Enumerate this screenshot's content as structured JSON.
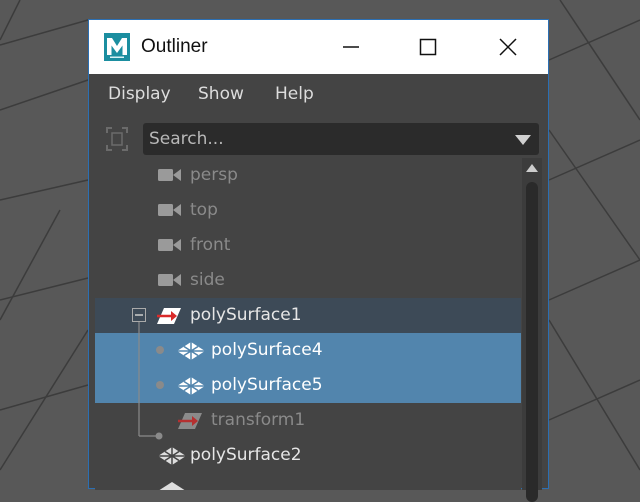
{
  "window": {
    "title": "Outliner",
    "accent_border": "#2b6fb3",
    "app_icon": "maya-logo-icon"
  },
  "menubar": {
    "items": [
      {
        "label": "Display"
      },
      {
        "label": "Show"
      },
      {
        "label": "Help"
      }
    ]
  },
  "search": {
    "placeholder": "Search...",
    "value": ""
  },
  "outliner": {
    "items": [
      {
        "label": "persp",
        "icon": "camera-icon",
        "state": "dim"
      },
      {
        "label": "top",
        "icon": "camera-icon",
        "state": "dim"
      },
      {
        "label": "front",
        "icon": "camera-icon",
        "state": "dim"
      },
      {
        "label": "side",
        "icon": "camera-icon",
        "state": "dim"
      },
      {
        "label": "polySurface1",
        "icon": "transform-icon",
        "state": "parent-highlight",
        "expanded": true
      },
      {
        "label": "polySurface4",
        "icon": "mesh-icon",
        "state": "selected"
      },
      {
        "label": "polySurface5",
        "icon": "mesh-icon",
        "state": "selected"
      },
      {
        "label": "transform1",
        "icon": "transform-icon",
        "state": "dim"
      },
      {
        "label": "polySurface2",
        "icon": "mesh-icon",
        "state": "normal"
      }
    ],
    "colors": {
      "selected": "#5285ad",
      "parent_highlight": "#3d4a57",
      "background": "#444444"
    }
  }
}
